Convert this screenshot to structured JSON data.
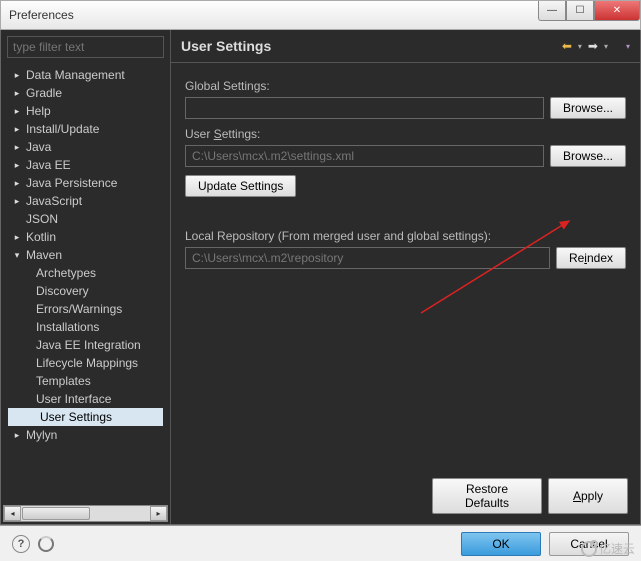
{
  "window": {
    "title": "Preferences"
  },
  "filter": {
    "placeholder": "type filter text"
  },
  "tree": {
    "items": [
      {
        "label": "Data Management",
        "level": 1,
        "exp": "▸"
      },
      {
        "label": "Gradle",
        "level": 1,
        "exp": "▸"
      },
      {
        "label": "Help",
        "level": 1,
        "exp": "▸"
      },
      {
        "label": "Install/Update",
        "level": 1,
        "exp": "▸"
      },
      {
        "label": "Java",
        "level": 1,
        "exp": "▸"
      },
      {
        "label": "Java EE",
        "level": 1,
        "exp": "▸"
      },
      {
        "label": "Java Persistence",
        "level": 1,
        "exp": "▸"
      },
      {
        "label": "JavaScript",
        "level": 1,
        "exp": "▸"
      },
      {
        "label": "JSON",
        "level": 1,
        "exp": ""
      },
      {
        "label": "Kotlin",
        "level": 1,
        "exp": "▸"
      },
      {
        "label": "Maven",
        "level": 1,
        "exp": "▾"
      },
      {
        "label": "Archetypes",
        "level": 2,
        "exp": ""
      },
      {
        "label": "Discovery",
        "level": 2,
        "exp": ""
      },
      {
        "label": "Errors/Warnings",
        "level": 2,
        "exp": ""
      },
      {
        "label": "Installations",
        "level": 2,
        "exp": ""
      },
      {
        "label": "Java EE Integration",
        "level": 2,
        "exp": ""
      },
      {
        "label": "Lifecycle Mappings",
        "level": 2,
        "exp": ""
      },
      {
        "label": "Templates",
        "level": 2,
        "exp": ""
      },
      {
        "label": "User Interface",
        "level": 2,
        "exp": ""
      },
      {
        "label": "User Settings",
        "level": 2,
        "exp": "",
        "selected": true
      },
      {
        "label": "Mylyn",
        "level": 1,
        "exp": "▸"
      }
    ]
  },
  "page": {
    "title": "User Settings",
    "global_label": "Global Settings:",
    "global_value": "",
    "browse1": "Browse...",
    "user_label_pre": "User ",
    "user_label_u": "S",
    "user_label_post": "ettings:",
    "user_value": "C:\\Users\\mcx\\.m2\\settings.xml",
    "browse2": "Browse...",
    "update": "Update Settings",
    "repo_label": "Local Repository (From merged user and global settings):",
    "repo_value": "C:\\Users\\mcx\\.m2\\repository",
    "reindex_pre": "Re",
    "reindex_u": "i",
    "reindex_post": "ndex",
    "restore": "Restore Defaults",
    "apply_pre": "",
    "apply_u": "A",
    "apply_post": "pply"
  },
  "footer": {
    "ok": "OK",
    "cancel": "Cancel"
  },
  "watermark": "亿速云"
}
